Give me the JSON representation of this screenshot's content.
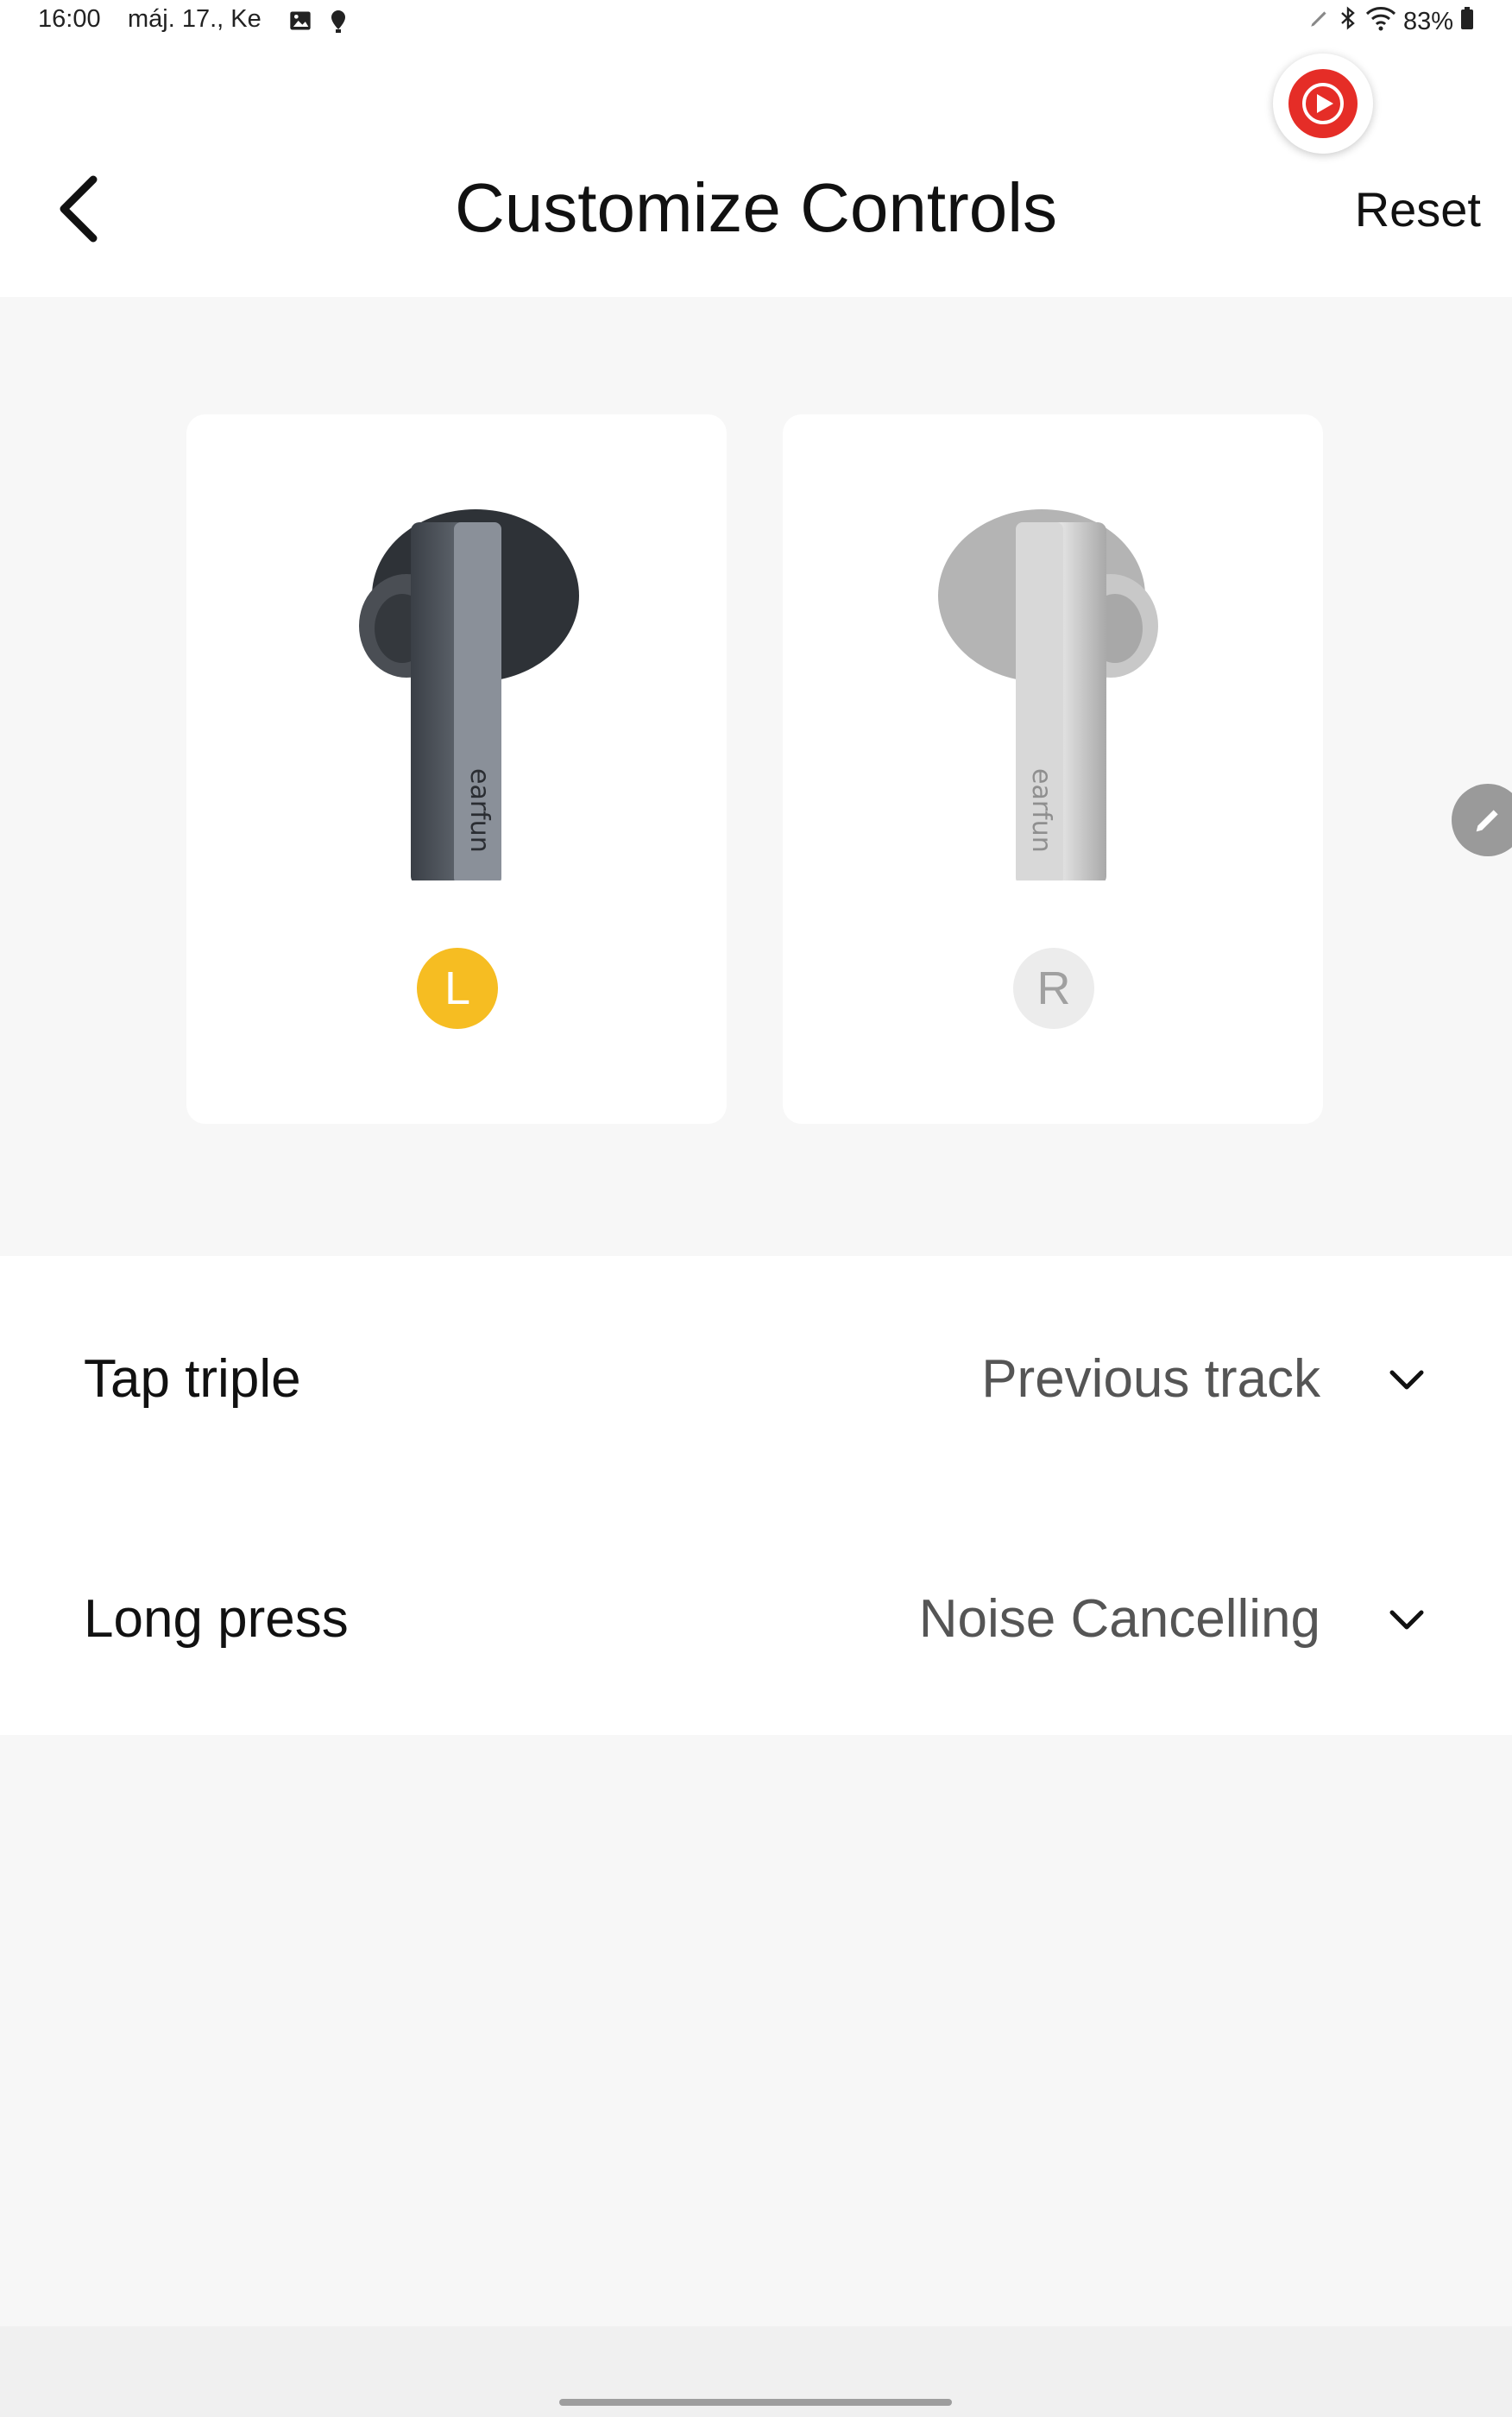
{
  "status_bar": {
    "time": "16:00",
    "date": "máj. 17., Ke",
    "battery": "83%",
    "icons": [
      "image-icon",
      "location-icon",
      "pen-icon",
      "bluetooth-icon",
      "wifi-icon",
      "battery-icon"
    ]
  },
  "header": {
    "title": "Customize Controls",
    "reset_label": "Reset",
    "back_icon": "chevron-left-icon"
  },
  "earbuds": {
    "left": {
      "badge": "L",
      "selected": true,
      "brand": "earfun",
      "badge_color": "#f6bd22"
    },
    "right": {
      "badge": "R",
      "selected": false,
      "brand": "earfun",
      "badge_color": "#ececec"
    }
  },
  "controls": [
    {
      "label": "Tap triple",
      "value": "Previous track"
    },
    {
      "label": "Long press",
      "value": "Noise Cancelling"
    }
  ],
  "colors": {
    "accent_yellow": "#f6bd22",
    "youtube_red": "#e52d27",
    "background": "#f7f7f7"
  }
}
